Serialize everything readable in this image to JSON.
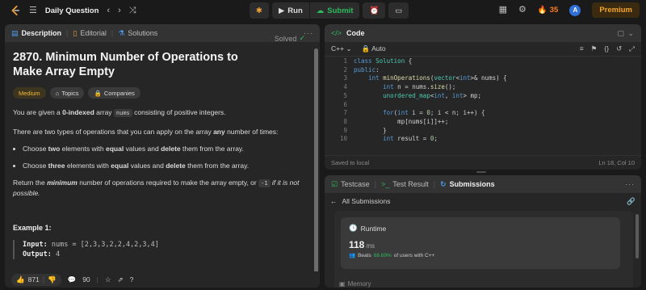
{
  "topbar": {
    "title": "Daily Question",
    "run_label": "Run",
    "submit_label": "Submit",
    "streak": "35",
    "avatar": "A",
    "premium": "Premium"
  },
  "description_panel": {
    "tabs": [
      "Description",
      "Editorial",
      "Solutions"
    ],
    "title": "2870. Minimum Number of Operations to Make Array Empty",
    "status": "Solved",
    "tags": [
      "Medium",
      "Topics",
      "Companies"
    ],
    "p1": {
      "a": "You are given a ",
      "b": "0-indexed",
      "c": " array ",
      "code": "nums",
      "d": " consisting of positive integers."
    },
    "p2": {
      "a": "There are two types of operations that you can apply on the array ",
      "b": "any",
      "c": " number of times:"
    },
    "bullet1": {
      "a": "Choose ",
      "b": "two",
      "c": " elements with ",
      "d": "equal",
      "e": " values and ",
      "f": "delete",
      "g": " them from the array."
    },
    "bullet2": {
      "a": "Choose ",
      "b": "three",
      "c": " elements with ",
      "d": "equal",
      "e": " values and ",
      "f": "delete",
      "g": " them from the array."
    },
    "p3": {
      "a": "Return the ",
      "b": "minimum",
      "c": " number of operations required to make the array empty, or ",
      "code": "-1",
      "d": " if it is not possible."
    },
    "example_heading": "Example 1:",
    "example": {
      "input_label": "Input:",
      "input_value": " nums = [2,3,3,2,2,4,2,3,4]",
      "output_label": "Output:",
      "output_value": " 4"
    },
    "footer": {
      "likes": "871",
      "comments": "90"
    }
  },
  "code_panel": {
    "title": "Code",
    "language": "C++",
    "mode": "Auto",
    "line_numbers": [
      "1",
      "2",
      "3",
      "4",
      "5",
      "6",
      "7",
      "8",
      "9",
      "10"
    ],
    "status_left": "Saved to local",
    "status_right": "Ln 18, Col 10"
  },
  "submissions_panel": {
    "tabs": [
      "Testcase",
      "Test Result",
      "Submissions"
    ],
    "back_label": "All Submissions",
    "runtime_label": "Runtime",
    "runtime_value": "118",
    "runtime_unit": "ms",
    "beats_label": "Beats",
    "beats_pct": "68.69%",
    "beats_suffix": "of users with C++",
    "memory_label": "Memory"
  },
  "colors": {
    "accent_green": "#2cbb5d",
    "medium": "#f5b82e",
    "premium": "#f5a623",
    "streak": "#ff7a1a"
  }
}
